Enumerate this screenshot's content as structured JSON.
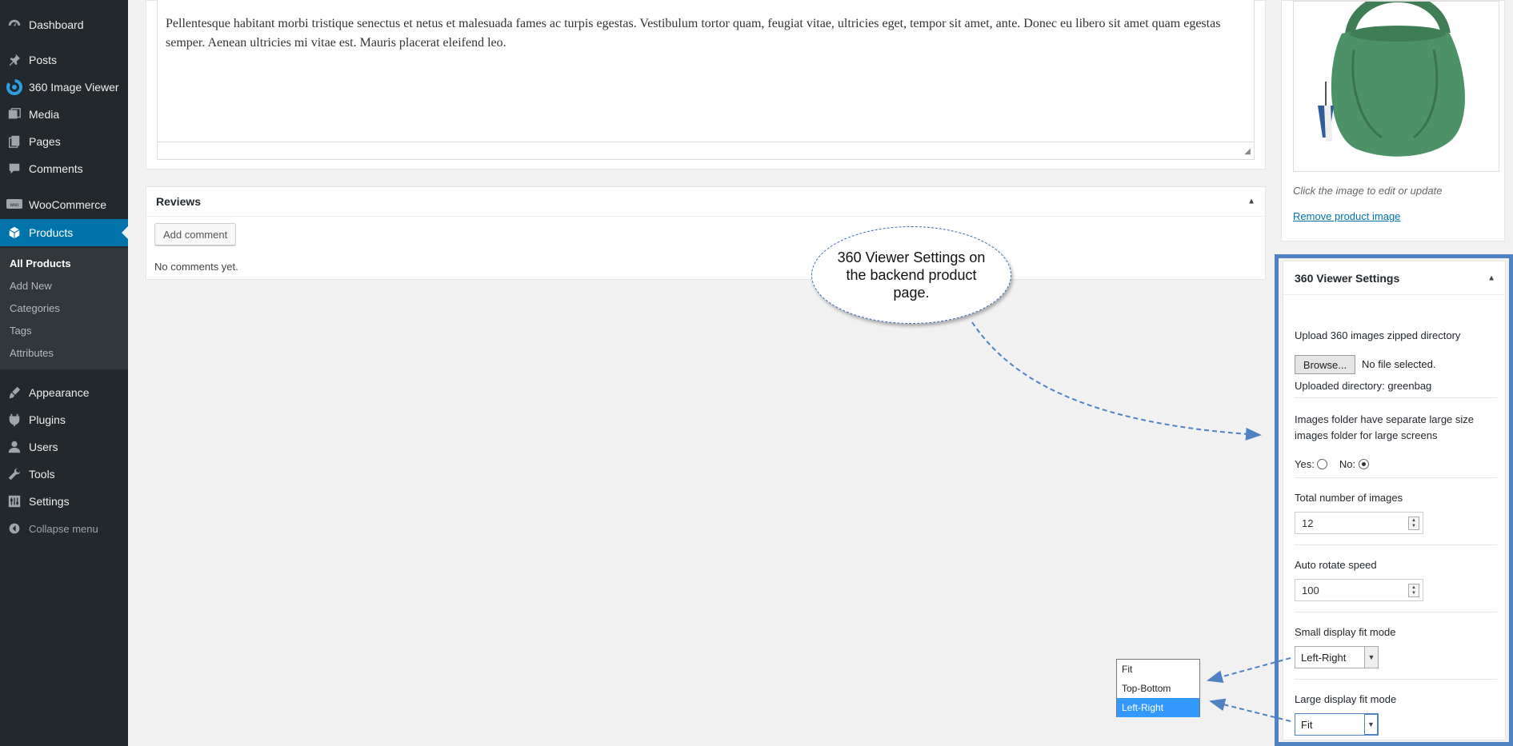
{
  "sidebar": {
    "items": [
      {
        "label": "Dashboard",
        "icon": "dashboard-icon"
      },
      {
        "label": "Posts",
        "icon": "pushpin-icon"
      },
      {
        "label": "360 Image Viewer",
        "icon": "rotate-360-icon"
      },
      {
        "label": "Media",
        "icon": "media-icon"
      },
      {
        "label": "Pages",
        "icon": "pages-icon"
      },
      {
        "label": "Comments",
        "icon": "comment-icon"
      },
      {
        "label": "WooCommerce",
        "icon": "woocommerce-icon"
      },
      {
        "label": "Products",
        "icon": "products-icon"
      },
      {
        "label": "Appearance",
        "icon": "paintbrush-icon"
      },
      {
        "label": "Plugins",
        "icon": "plug-icon"
      },
      {
        "label": "Users",
        "icon": "user-icon"
      },
      {
        "label": "Tools",
        "icon": "wrench-icon"
      },
      {
        "label": "Settings",
        "icon": "settings-icon"
      },
      {
        "label": "Collapse menu",
        "icon": "collapse-icon"
      }
    ],
    "submenu": [
      "All Products",
      "Add New",
      "Categories",
      "Tags",
      "Attributes"
    ],
    "accent": "#0073aa"
  },
  "editor": {
    "content": "Pellentesque habitant morbi tristique senectus et netus et malesuada fames ac turpis egestas. Vestibulum tortor quam, feugiat vitae, ultricies eget, tempor sit amet, ante. Donec eu libero sit amet quam egestas semper. Aenean ultricies mi vitae est. Mauris placerat eleifend leo."
  },
  "reviews": {
    "title": "Reviews",
    "add_comment": "Add comment",
    "empty": "No comments yet."
  },
  "product_image": {
    "caption": "Click the image to edit or update",
    "remove": "Remove product image"
  },
  "viewer_settings": {
    "title": "360 Viewer Settings",
    "upload_label": "Upload 360 images zipped directory",
    "browse": "Browse...",
    "no_file": "No file selected.",
    "uploaded_dir": "Uploaded directory: greenbag",
    "separate_large": "Images folder have separate large size images folder for large screens",
    "yes": "Yes:",
    "no": "No:",
    "selected_option": "No",
    "total_label": "Total number of images",
    "total_value": "12",
    "speed_label": "Auto rotate speed",
    "speed_value": "100",
    "small_label": "Small display fit mode",
    "small_value": "Left-Right",
    "large_label": "Large display fit mode",
    "large_value": "Fit"
  },
  "dropdown": {
    "options": [
      "Fit",
      "Top-Bottom",
      "Left-Right"
    ],
    "highlighted": "Left-Right"
  },
  "callout": {
    "text": "360 Viewer Settings on the backend product page."
  },
  "colors": {
    "annotation": "#4f82c4",
    "highlight": "#3399ff"
  }
}
